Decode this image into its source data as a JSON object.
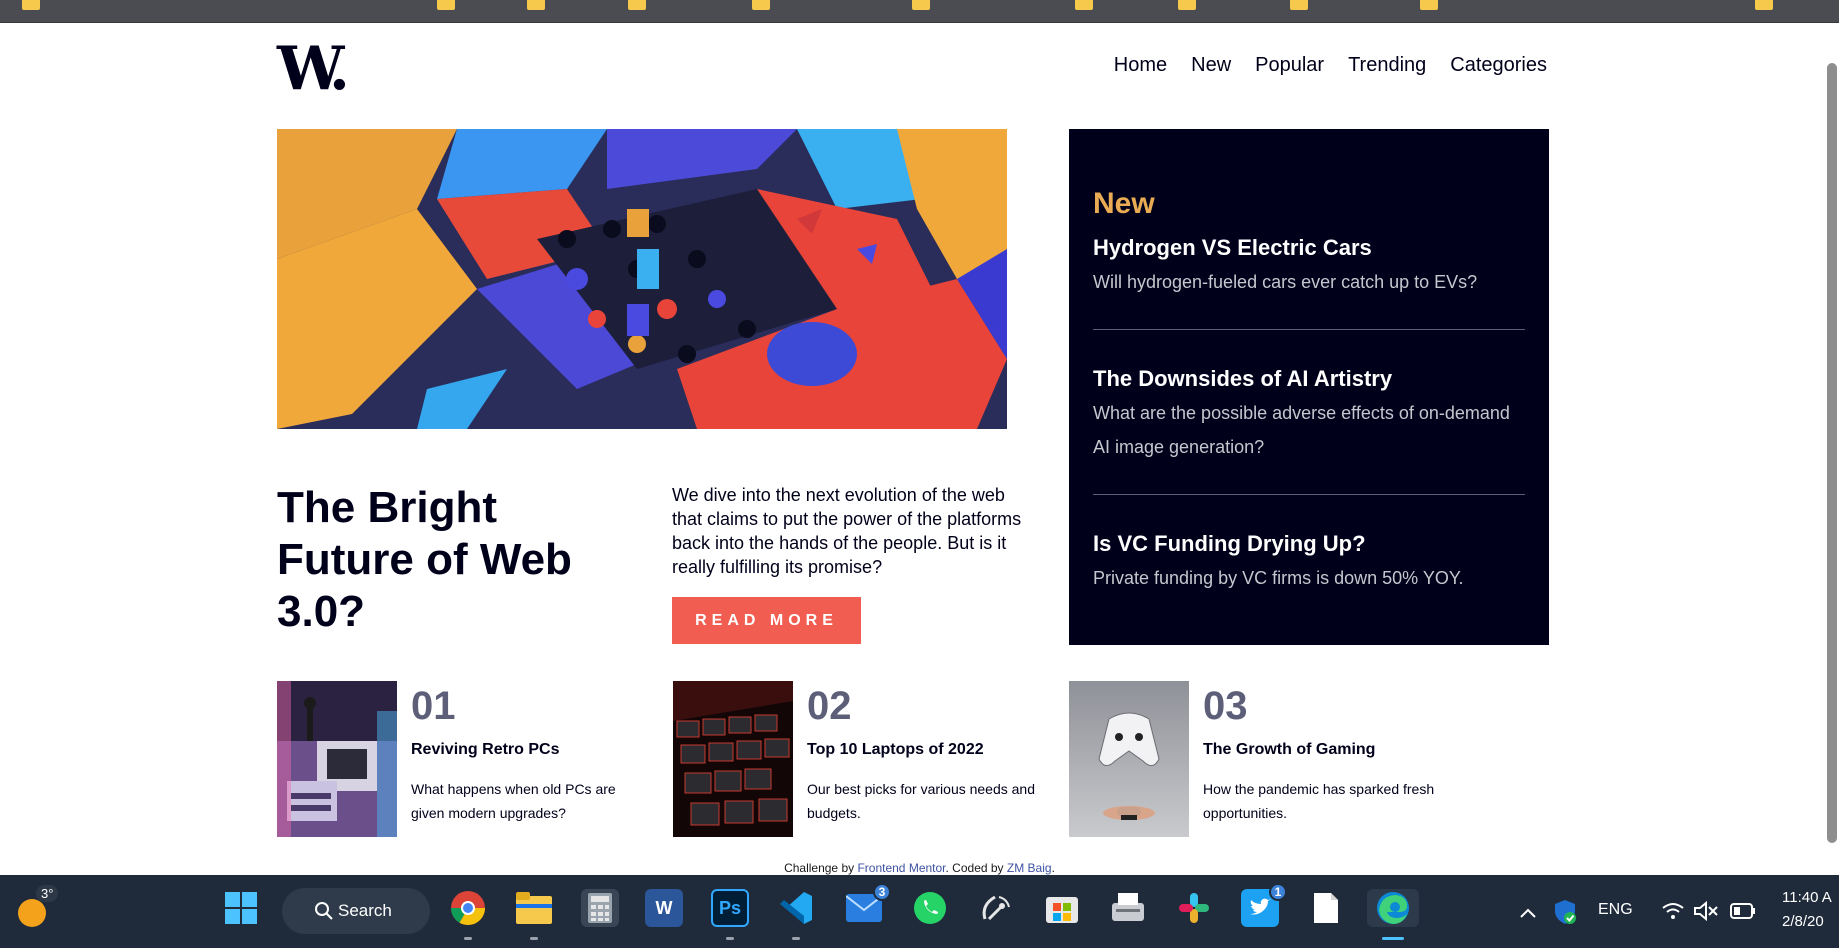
{
  "site": {
    "logo": "W.",
    "nav": [
      "Home",
      "New",
      "Popular",
      "Trending",
      "Categories"
    ]
  },
  "hero": {
    "title": "The Bright Future of Web 3.0?",
    "description": "We dive into the next evolution of the web that claims to put the power of the platforms back into the hands of the people. But is it really fulfilling its promise?",
    "button_label": "READ MORE"
  },
  "new_panel": {
    "heading": "New",
    "items": [
      {
        "title": "Hydrogen VS Electric Cars",
        "text": "Will hydrogen-fueled cars ever catch up to EVs?"
      },
      {
        "title": "The Downsides of AI Artistry",
        "text": "What are the possible adverse effects of on-demand AI image generation?"
      },
      {
        "title": "Is VC Funding Drying Up?",
        "text": "Private funding by VC firms is down 50% YOY."
      }
    ]
  },
  "cards": [
    {
      "number": "01",
      "title": "Reviving Retro PCs",
      "text": "What happens when old PCs are given modern upgrades?"
    },
    {
      "number": "02",
      "title": "Top 10 Laptops of 2022",
      "text": "Our best picks for various needs and budgets."
    },
    {
      "number": "03",
      "title": "The Growth of Gaming",
      "text": "How the pandemic has sparked fresh opportunities."
    }
  ],
  "attribution": {
    "prefix": "Challenge by ",
    "mentor_link": "Frontend Mentor",
    "middle": ". Coded by ",
    "author_link": "ZM Baig",
    "suffix": "."
  },
  "taskbar": {
    "weather_temp": "3°",
    "search_label": "Search",
    "mail_badge": "3",
    "twitter_badge": "1",
    "language": "ENG",
    "time": "11:40 A",
    "date": "2/8/20"
  },
  "colors": {
    "accent_orange": "#e9ab53",
    "button_red": "#f15d51",
    "dark_navy": "#00001a",
    "muted_gray": "#5d5f79"
  }
}
